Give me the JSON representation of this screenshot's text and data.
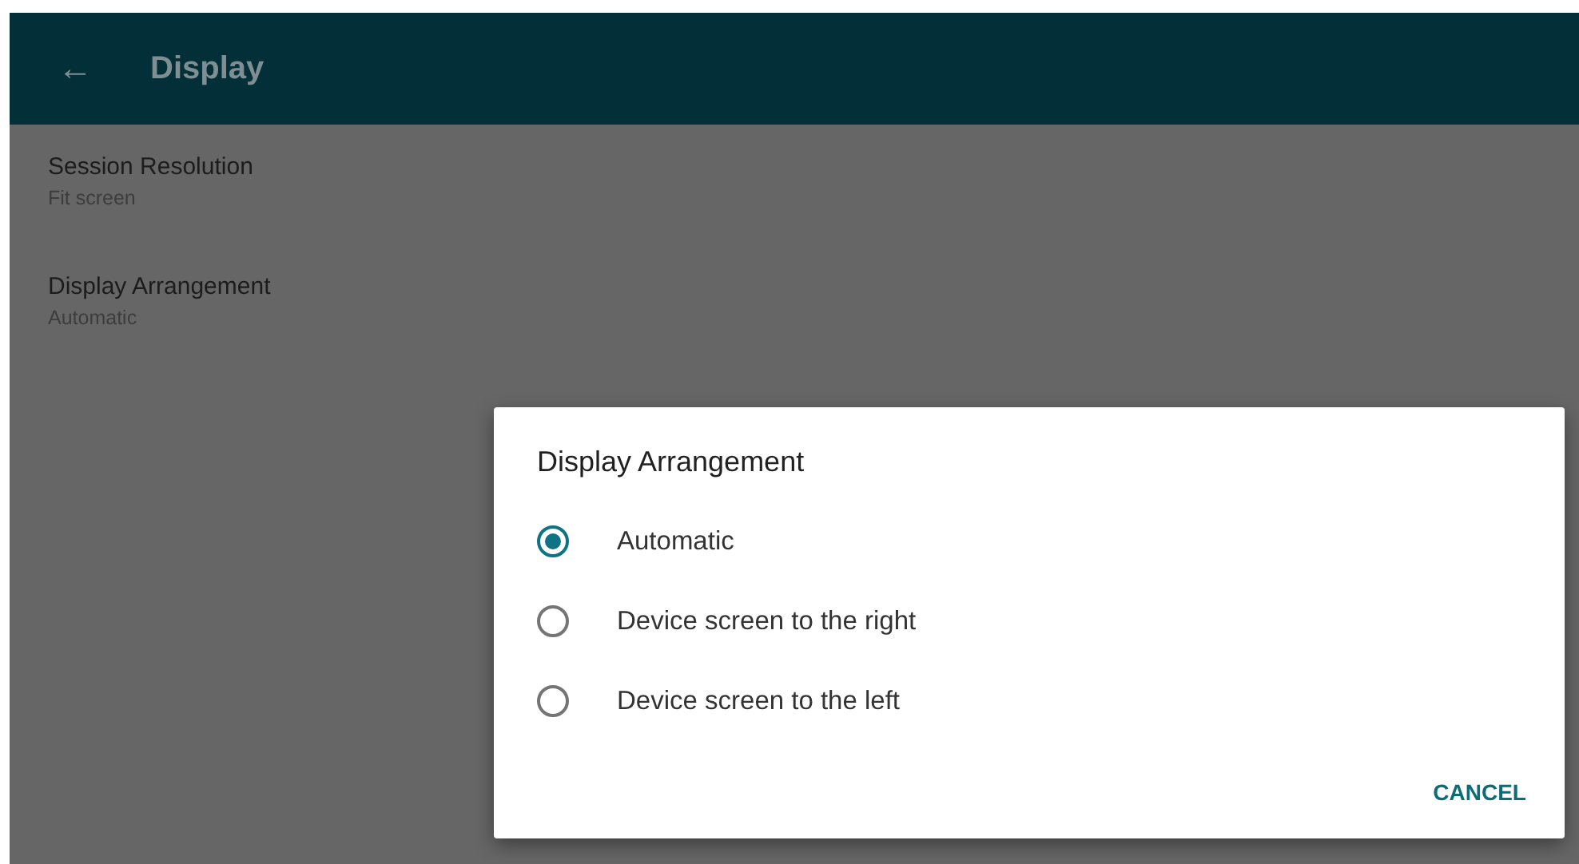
{
  "app_bar": {
    "title": "Display",
    "back_icon": "←"
  },
  "settings": [
    {
      "title": "Session Resolution",
      "value": "Fit screen"
    },
    {
      "title": "Display Arrangement",
      "value": "Automatic"
    }
  ],
  "dialog": {
    "title": "Display Arrangement",
    "options": [
      {
        "label": "Automatic",
        "selected": true
      },
      {
        "label": "Device screen to the right",
        "selected": false
      },
      {
        "label": "Device screen to the left",
        "selected": false
      }
    ],
    "buttons": [
      "CANCEL"
    ]
  }
}
